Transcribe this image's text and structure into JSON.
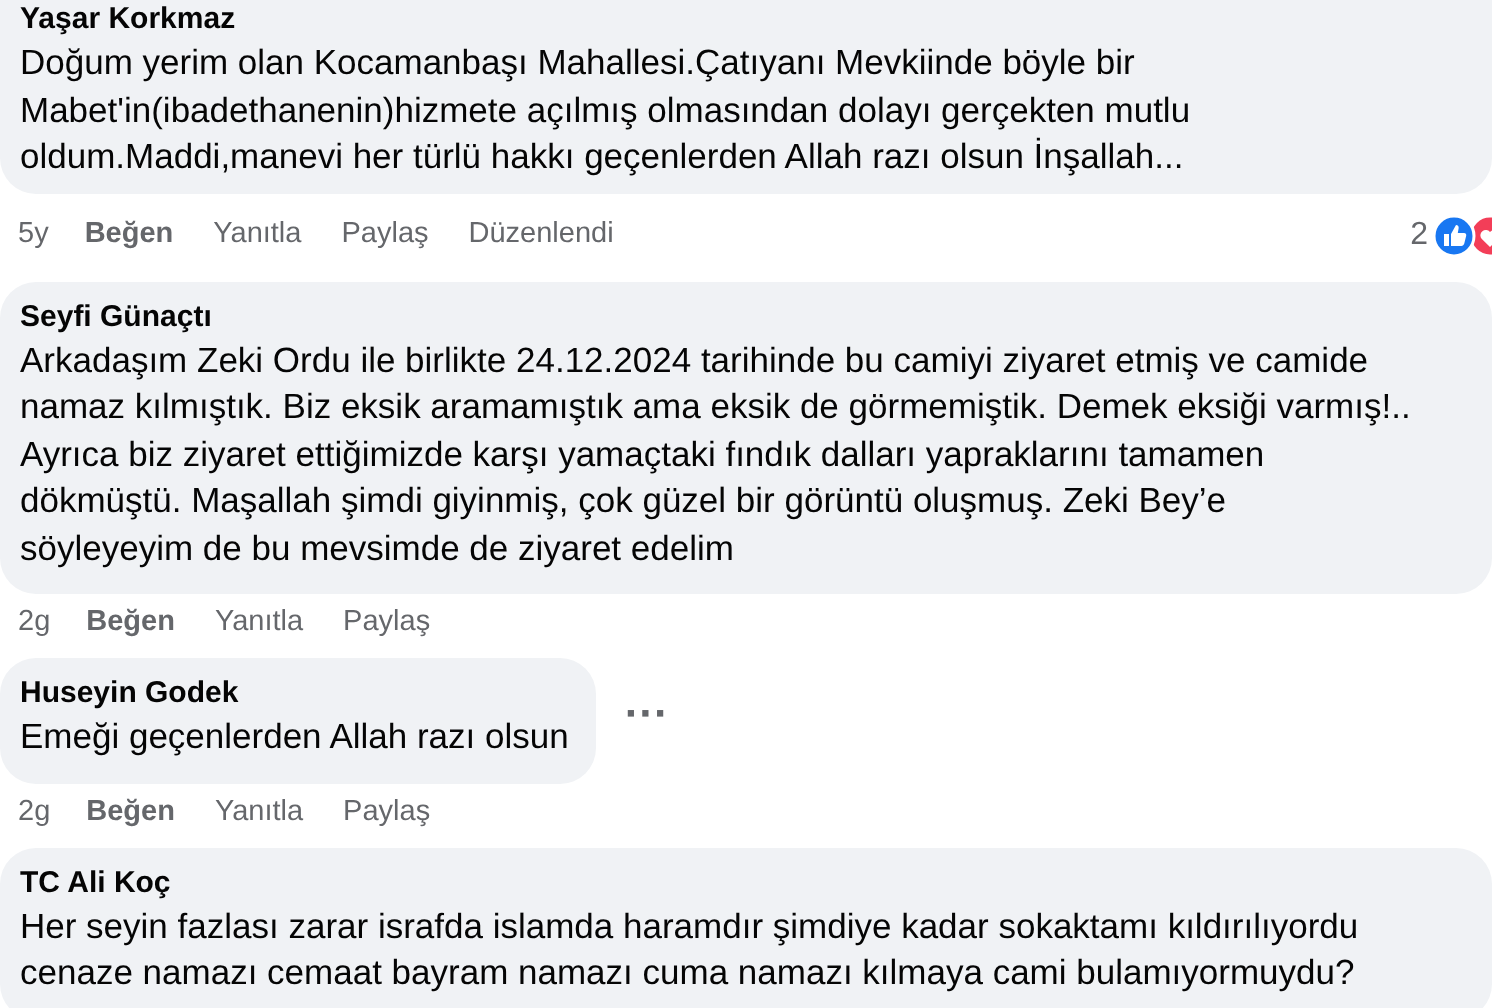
{
  "comments": [
    {
      "author": "Yaşar Korkmaz",
      "lines": [
        "Doğum yerim olan Kocamanbaşı Mahallesi.Çatıyanı Mevkiinde böyle bir",
        "Mabet'in(ibadethanenin)hizmete açılmış olmasından dolayı gerçekten mutlu",
        "oldum.Maddi,manevi her türlü hakkı geçenlerden Allah razı olsun İnşallah..."
      ],
      "time": "5y",
      "actions": [
        {
          "kind": "like",
          "label": "Beğen"
        },
        {
          "kind": "reply",
          "label": "Yanıtla"
        },
        {
          "kind": "share",
          "label": "Paylaş"
        },
        {
          "kind": "edited",
          "label": "Düzenlendi"
        }
      ],
      "reactions": {
        "count": "2"
      }
    },
    {
      "author": "Seyfi Günaçtı",
      "lines": [
        "Arkadaşım Zeki Ordu ile birlikte 24.12.2024 tarihinde bu camiyi ziyaret etmiş ve camide",
        "namaz kılmıştık. Biz eksik aramamıştık ama eksik de görmemiştik. Demek eksiği varmış!..",
        "Ayrıca biz ziyaret ettiğimizde karşı yamaçtaki fındık dalları yapraklarını tamamen",
        "dökmüştü. Maşallah şimdi giyinmiş, çok güzel bir görüntü oluşmuş. Zeki Bey’e",
        "söyleyeyim de bu mevsimde de ziyaret edelim"
      ],
      "time": "2g",
      "actions": [
        {
          "kind": "like",
          "label": "Beğen"
        },
        {
          "kind": "reply",
          "label": "Yanıtla"
        },
        {
          "kind": "share",
          "label": "Paylaş"
        }
      ]
    },
    {
      "author": "Huseyin Godek",
      "lines": [
        "Emeği geçenlerden Allah razı olsun"
      ],
      "time": "2g",
      "actions": [
        {
          "kind": "like",
          "label": "Beğen"
        },
        {
          "kind": "reply",
          "label": "Yanıtla"
        },
        {
          "kind": "share",
          "label": "Paylaş"
        }
      ],
      "menu": "···"
    },
    {
      "author": "TC Ali Koç",
      "lines": [
        "Her seyin fazlası zarar israfda islamda haramdır şimdiye kadar sokaktamı kıldırılıyordu",
        "cenaze namazı cemaat bayram namazı cuma namazı kılmaya cami bulamıyormuydu?"
      ]
    }
  ]
}
